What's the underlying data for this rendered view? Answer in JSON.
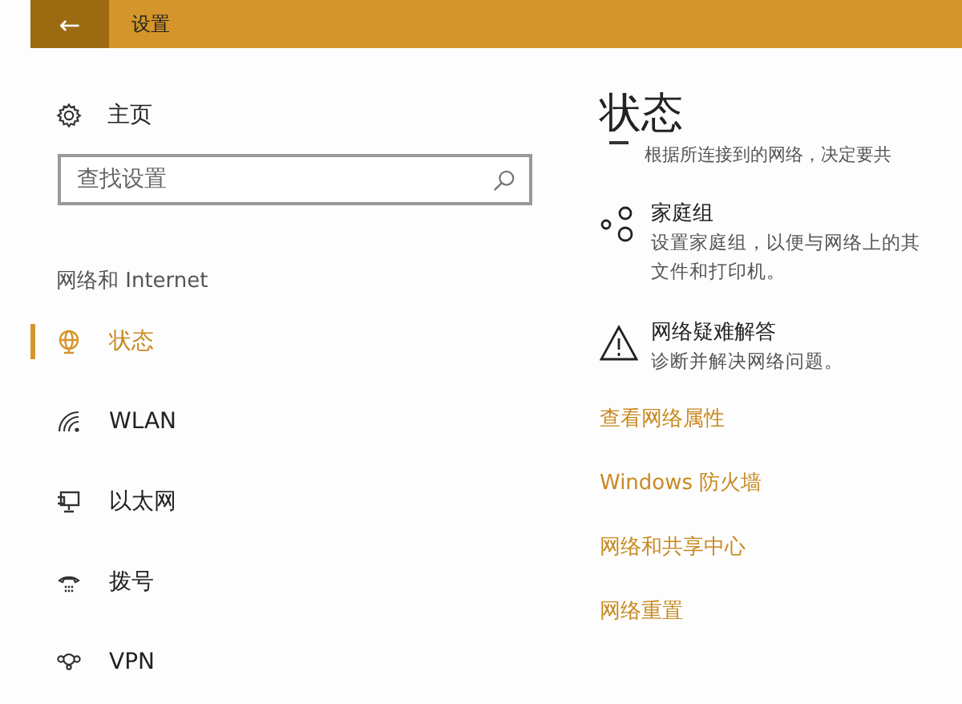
{
  "title_bar": {
    "back": "←",
    "title": "设置"
  },
  "sidebar": {
    "home": "主页",
    "search": {
      "placeholder": "查找设置"
    },
    "section": "网络和 Internet",
    "items": [
      {
        "label": "状态",
        "kind": "globe",
        "selected": true
      },
      {
        "label": "WLAN",
        "kind": "wifi",
        "selected": false
      },
      {
        "label": "以太网",
        "kind": "ethernet",
        "selected": false
      },
      {
        "label": "拨号",
        "kind": "dialup",
        "selected": false
      },
      {
        "label": "VPN",
        "kind": "vpn",
        "selected": false
      }
    ]
  },
  "main": {
    "heading": "状态",
    "cut_text": "根据所连接到的网络，决定要共",
    "entries": [
      {
        "kind": "homegroup",
        "title": "家庭组",
        "description": [
          "设置家庭组，以便与网络上的其",
          "文件和打印机。"
        ]
      },
      {
        "kind": "warning",
        "title": "网络疑难解答",
        "description": [
          "诊断并解决网络问题。"
        ]
      }
    ],
    "links": [
      "查看网络属性",
      "Windows 防火墙",
      "网络和共享中心",
      "网络重置"
    ]
  }
}
